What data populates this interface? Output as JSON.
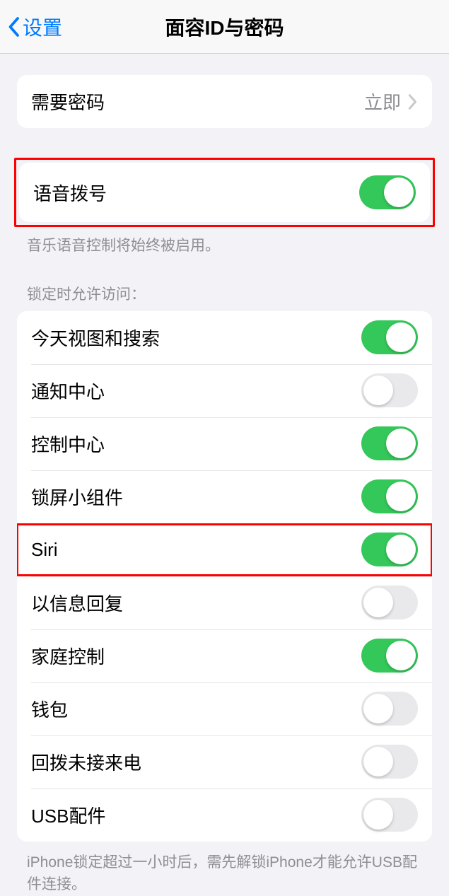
{
  "nav": {
    "back_label": "设置",
    "title": "面容ID与密码"
  },
  "passcode": {
    "require_label": "需要密码",
    "require_value": "立即"
  },
  "voice_dial": {
    "label": "语音拨号",
    "on": true,
    "footer": "音乐语音控制将始终被启用。"
  },
  "lock_access": {
    "header": "锁定时允许访问：",
    "items": [
      {
        "label": "今天视图和搜索",
        "on": true
      },
      {
        "label": "通知中心",
        "on": false
      },
      {
        "label": "控制中心",
        "on": true
      },
      {
        "label": "锁屏小组件",
        "on": true
      },
      {
        "label": "Siri",
        "on": true,
        "highlight": true
      },
      {
        "label": "以信息回复",
        "on": false
      },
      {
        "label": "家庭控制",
        "on": true
      },
      {
        "label": "钱包",
        "on": false
      },
      {
        "label": "回拨未接来电",
        "on": false
      },
      {
        "label": "USB配件",
        "on": false
      }
    ],
    "footer": "iPhone锁定超过一小时后，需先解锁iPhone才能允许USB配件连接。"
  }
}
